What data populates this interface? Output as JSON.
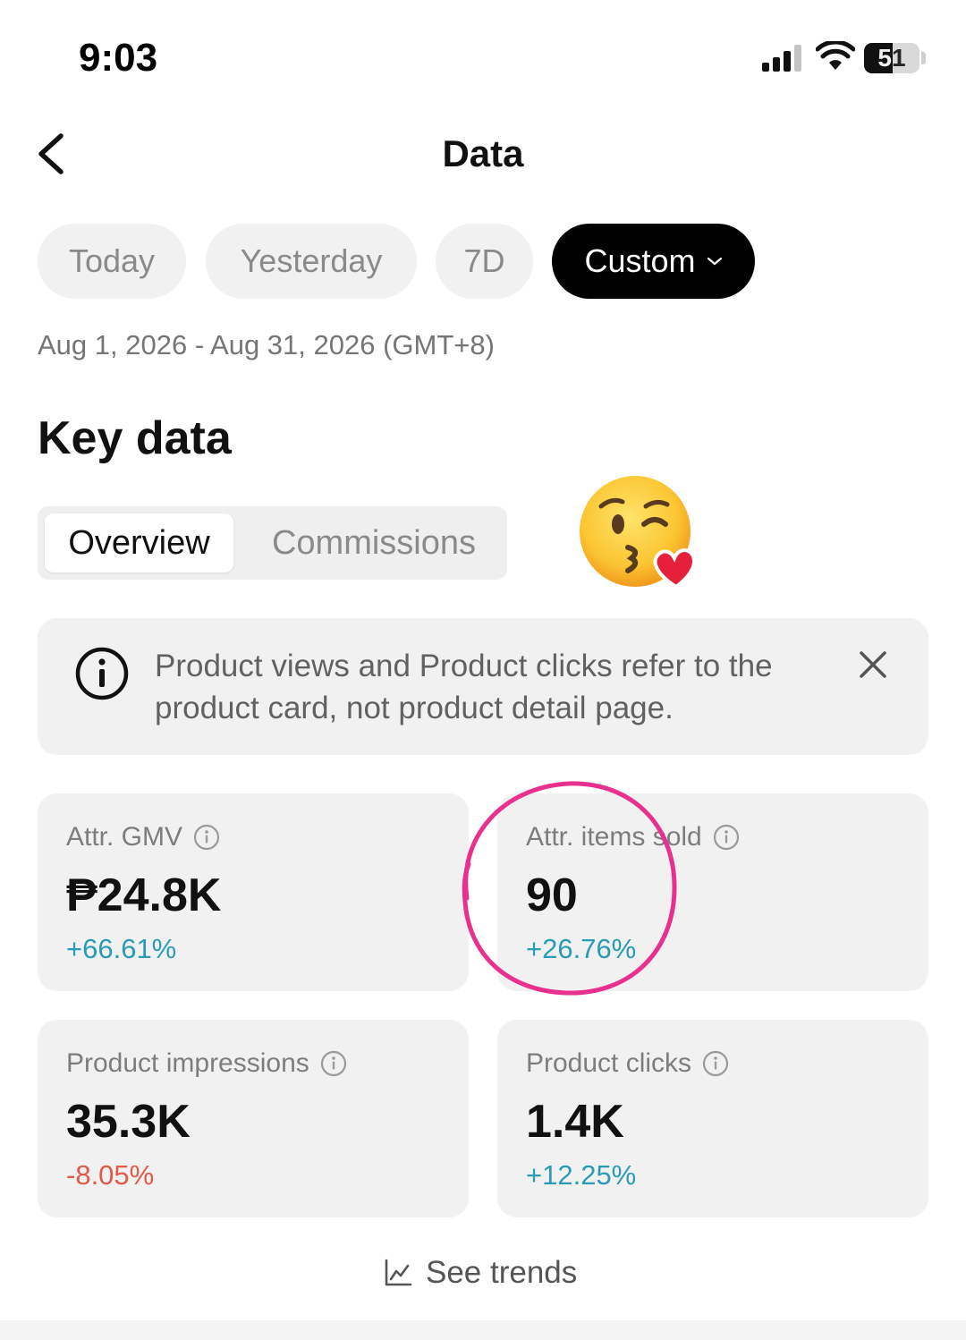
{
  "status_bar": {
    "time": "9:03",
    "battery": "51"
  },
  "header": {
    "title": "Data"
  },
  "periods": [
    {
      "label": "Today"
    },
    {
      "label": "Yesterday"
    },
    {
      "label": "7D"
    },
    {
      "label": "Custom",
      "selected": true
    }
  ],
  "date_range": "Aug 1, 2026 - Aug 31, 2026 (GMT+8)",
  "section_title": "Key data",
  "segments": [
    {
      "label": "Overview",
      "selected": true
    },
    {
      "label": "Commissions"
    }
  ],
  "banner": {
    "text": "Product views and Product clicks refer to the product card, not product detail page."
  },
  "metrics": [
    {
      "label": "Attr. GMV",
      "value": "₱24.8K",
      "change": "+66.61%",
      "trend": "up"
    },
    {
      "label": "Attr. items sold",
      "value": "90",
      "change": "+26.76%",
      "trend": "up"
    },
    {
      "label": "Product impressions",
      "value": "35.3K",
      "change": "-8.05%",
      "trend": "down"
    },
    {
      "label": "Product clicks",
      "value": "1.4K",
      "change": "+12.25%",
      "trend": "up"
    }
  ],
  "trends_link": "See trends",
  "colors": {
    "positive": "#2a9bb5",
    "negative": "#e05a47",
    "highlight_circle": "#e8318e",
    "chip_active": "#000000"
  },
  "icons": [
    "back-chevron-icon",
    "info-icon",
    "close-icon",
    "chart-icon",
    "kiss-emoji"
  ]
}
